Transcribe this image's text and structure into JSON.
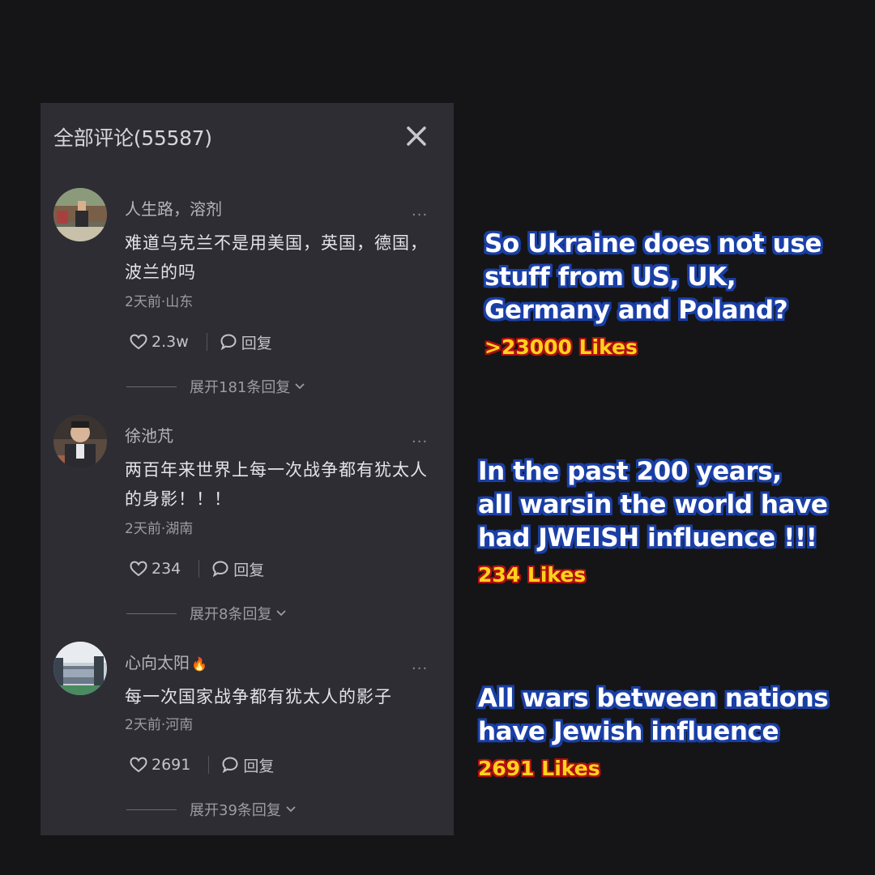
{
  "panel": {
    "title": "全部评论(55587)",
    "close_icon": "close-icon"
  },
  "comments": [
    {
      "username": "人生路，溶剂",
      "text": "难道乌克兰不是用美国，英国，德国，波兰的吗",
      "meta": "2天前·山东",
      "likes": "2.3w",
      "reply_label": "回复",
      "expand_label": "展开181条回复",
      "more_label": "..."
    },
    {
      "username": "徐池芃",
      "text": "两百年来世界上每一次战争都有犹太人的身影！！！",
      "meta": "2天前·湖南",
      "likes": "234",
      "reply_label": "回复",
      "expand_label": "展开8条回复",
      "more_label": "..."
    },
    {
      "username": "心向太阳",
      "username_emoji": "🔥",
      "text": "每一次国家战争都有犹太人的影子",
      "meta": "2天前·河南",
      "likes": "2691",
      "reply_label": "回复",
      "expand_label": "展开39条回复",
      "more_label": "..."
    }
  ],
  "captions": [
    {
      "text": "So Ukraine does not use\nstuff from US, UK,\nGermany and Poland?",
      "likes": ">23000 Likes"
    },
    {
      "text": "In the past 200 years,\nall warsin the world have\nhad JWEISH influence !!!",
      "likes": "234 Likes"
    },
    {
      "text": "All wars between nations\nhave Jewish influence",
      "likes": "2691 Likes"
    }
  ],
  "colors": {
    "background": "#151517",
    "panel": "#2d2d33",
    "caption_text": "#ffffff",
    "caption_outline": "#1a3fa6",
    "likes_text": "#ffd21c",
    "likes_outline": "#b01010"
  },
  "icons": [
    "close-icon",
    "heart-icon",
    "comment-bubble-icon",
    "chevron-down-icon",
    "more-icon"
  ]
}
